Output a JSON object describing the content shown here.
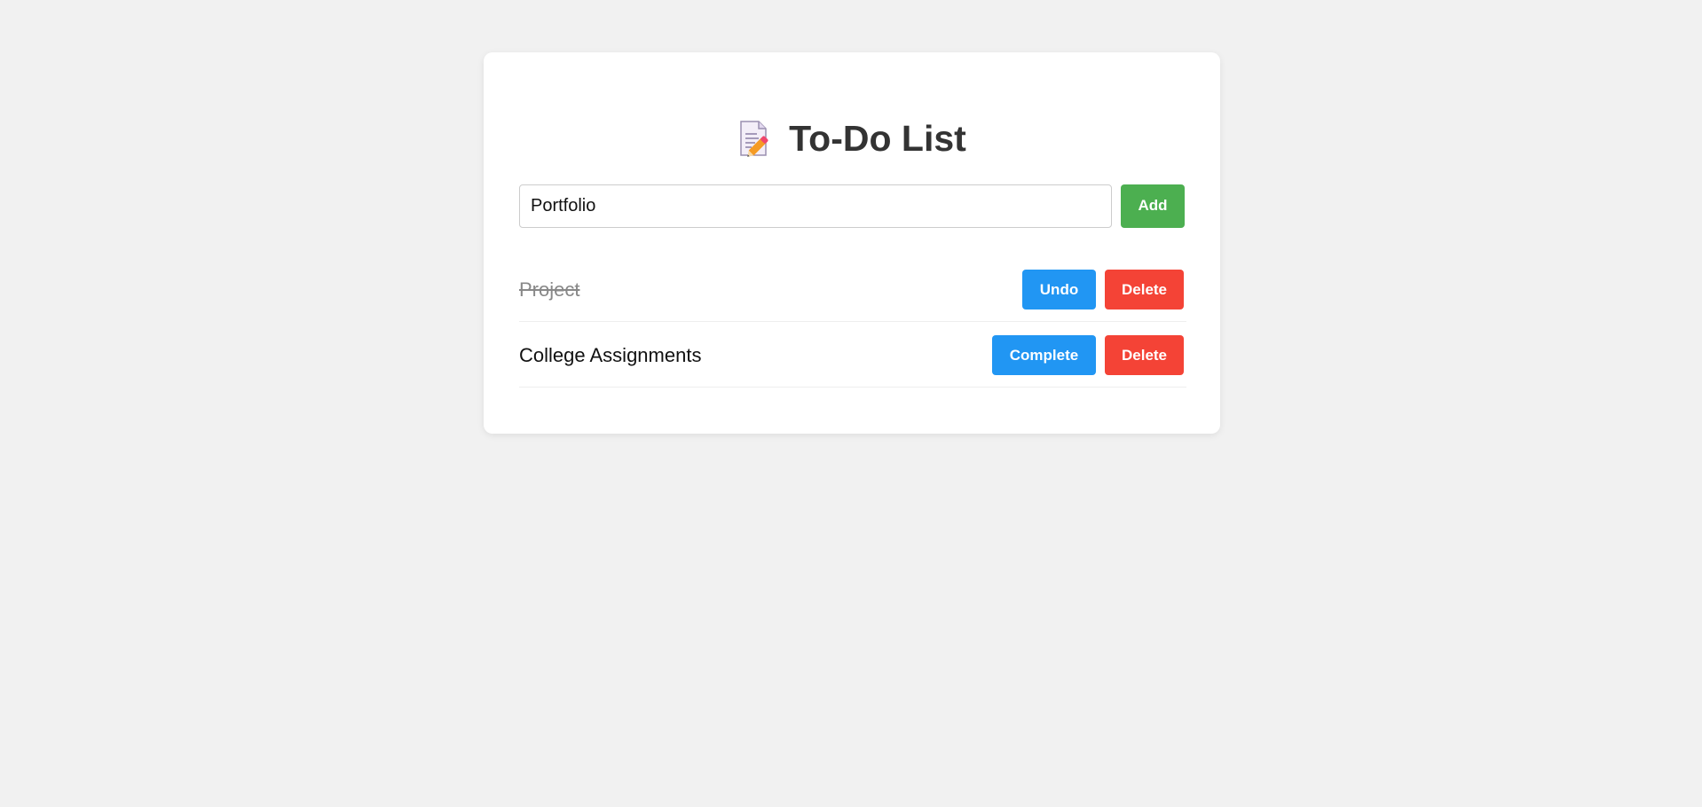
{
  "app": {
    "title": "To-Do List",
    "title_icon": "memo-pencil-icon"
  },
  "new_task": {
    "value": "Portfolio",
    "add_label": "Add"
  },
  "tasks": [
    {
      "text": "Project",
      "completed": true,
      "toggle_label": "Undo",
      "delete_label": "Delete"
    },
    {
      "text": "College Assignments",
      "completed": false,
      "toggle_label": "Complete",
      "delete_label": "Delete"
    }
  ],
  "colors": {
    "add": "#4caf50",
    "toggle": "#2196f3",
    "delete": "#f44336",
    "background": "#f1f1f1"
  }
}
